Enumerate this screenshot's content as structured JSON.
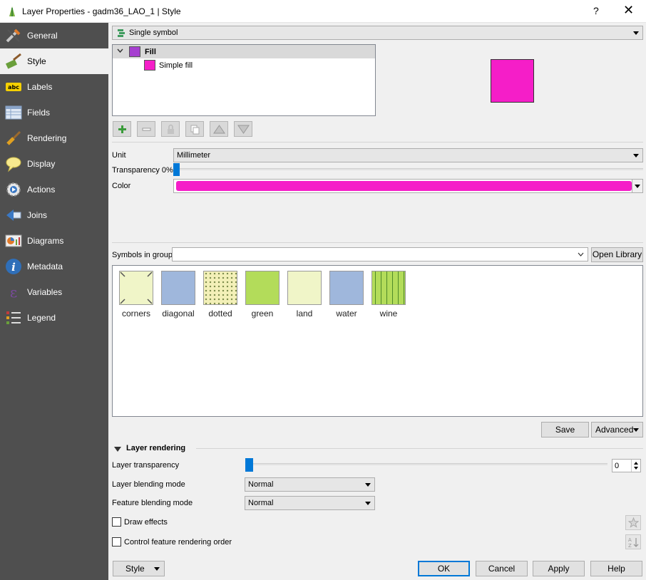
{
  "window": {
    "title": "Layer Properties - gadm36_LAO_1 | Style",
    "help_label": "?",
    "close_label": "✕"
  },
  "sidebar": {
    "items": [
      {
        "label": "General",
        "icon": "wrench-icon"
      },
      {
        "label": "Style",
        "icon": "paintbrush-icon"
      },
      {
        "label": "Labels",
        "icon": "abc-label-icon"
      },
      {
        "label": "Fields",
        "icon": "table-icon"
      },
      {
        "label": "Rendering",
        "icon": "brush-icon"
      },
      {
        "label": "Display",
        "icon": "speech-bubble-icon"
      },
      {
        "label": "Actions",
        "icon": "gear-play-icon"
      },
      {
        "label": "Joins",
        "icon": "join-icon"
      },
      {
        "label": "Diagrams",
        "icon": "chart-icon"
      },
      {
        "label": "Metadata",
        "icon": "info-icon"
      },
      {
        "label": "Variables",
        "icon": "epsilon-icon"
      },
      {
        "label": "Legend",
        "icon": "legend-icon"
      }
    ],
    "active": "Style"
  },
  "renderer": {
    "type_label": "Single symbol"
  },
  "symbol_tree": {
    "root_label": "Fill",
    "child_label": "Simple fill",
    "fill_color": "#a63fd0",
    "simple_fill_color": "#f51ec8"
  },
  "preview": {
    "color": "#f51ec8"
  },
  "symbol_props": {
    "unit_label": "Unit",
    "unit_value": "Millimeter",
    "transparency_label": "Transparency 0%",
    "color_label": "Color",
    "color_value": "#f51ec8"
  },
  "library": {
    "group_label": "Symbols in group",
    "group_value": "",
    "open_library_label": "Open Library",
    "symbols": [
      {
        "name": "corners",
        "color": "#f0f5c8"
      },
      {
        "name": "diagonal",
        "color": "#9fb7dc"
      },
      {
        "name": "dotted",
        "color": "#f3f0b8"
      },
      {
        "name": "green",
        "color": "#b3dc5a"
      },
      {
        "name": "land",
        "color": "#f0f5c8"
      },
      {
        "name": "water",
        "color": "#9fb7dc"
      },
      {
        "name": "wine",
        "color": "#b3dc5a"
      }
    ],
    "save_label": "Save",
    "advanced_label": "Advanced"
  },
  "layer_rendering": {
    "section_label": "Layer rendering",
    "transparency_label": "Layer transparency",
    "transparency_value": "0",
    "blending_label": "Layer blending mode",
    "blending_value": "Normal",
    "feature_blending_label": "Feature blending mode",
    "feature_blending_value": "Normal",
    "draw_effects_label": "Draw effects",
    "order_label": "Control feature rendering order"
  },
  "footer": {
    "style_label": "Style",
    "ok_label": "OK",
    "cancel_label": "Cancel",
    "apply_label": "Apply",
    "help_label": "Help"
  },
  "colors": {
    "sidebar_bg": "#4f4f4f",
    "accent": "#0078d7"
  }
}
